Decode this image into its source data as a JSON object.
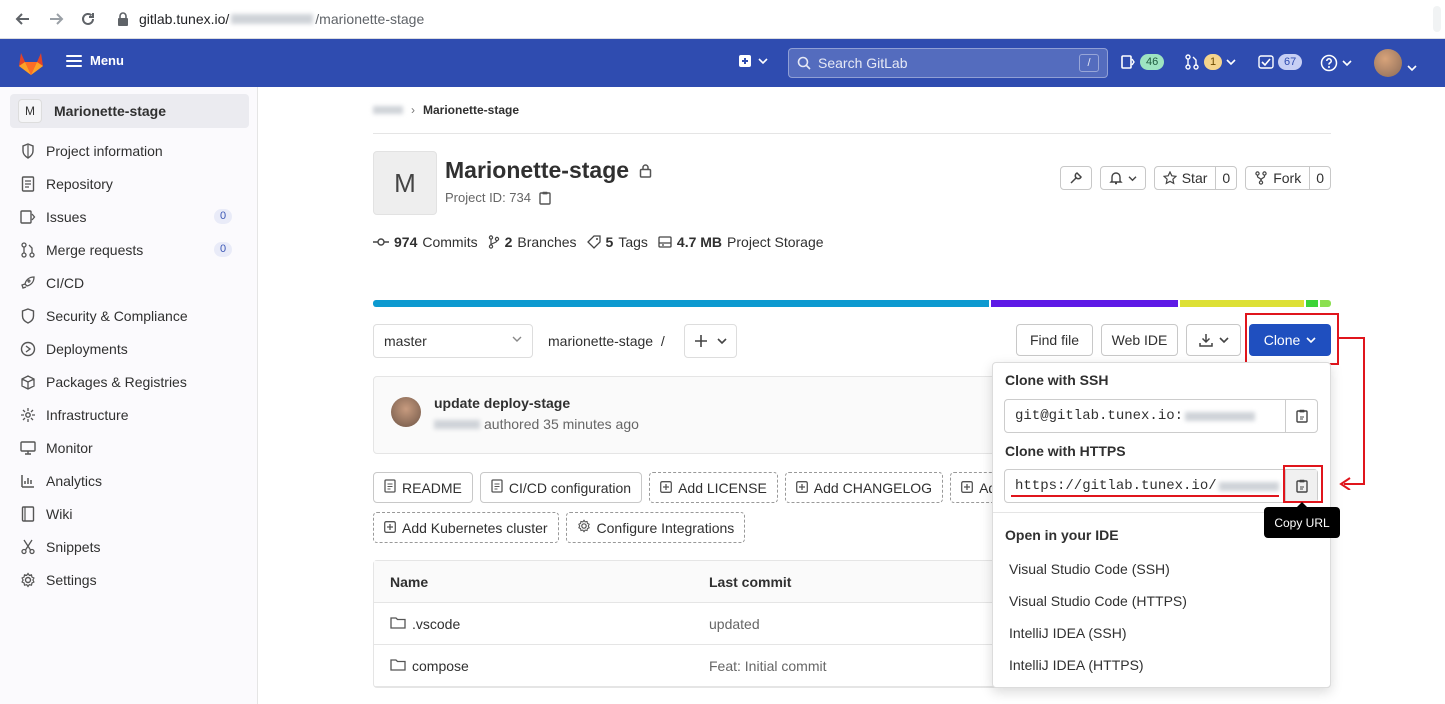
{
  "browser": {
    "url_host": "gitlab.tunex.io/",
    "url_path": "/marionette-stage"
  },
  "header": {
    "menu_label": "Menu",
    "search_placeholder": "Search GitLab",
    "search_shortcut": "/",
    "issues_count": "46",
    "mr_count": "1",
    "todos_count": "67"
  },
  "sidebar": {
    "project_initial": "M",
    "project_name": "Marionette-stage",
    "items": [
      {
        "label": "Project information",
        "icon": "info-icon"
      },
      {
        "label": "Repository",
        "icon": "doc-icon"
      },
      {
        "label": "Issues",
        "icon": "issues-icon",
        "badge": "0"
      },
      {
        "label": "Merge requests",
        "icon": "merge-request-icon",
        "badge": "0"
      },
      {
        "label": "CI/CD",
        "icon": "rocket-icon"
      },
      {
        "label": "Security & Compliance",
        "icon": "shield-icon"
      },
      {
        "label": "Deployments",
        "icon": "deployments-icon"
      },
      {
        "label": "Packages & Registries",
        "icon": "package-icon"
      },
      {
        "label": "Infrastructure",
        "icon": "cloud-icon"
      },
      {
        "label": "Monitor",
        "icon": "monitor-icon"
      },
      {
        "label": "Analytics",
        "icon": "chart-icon"
      },
      {
        "label": "Wiki",
        "icon": "book-icon"
      },
      {
        "label": "Snippets",
        "icon": "snippet-icon"
      },
      {
        "label": "Settings",
        "icon": "gear-icon"
      }
    ]
  },
  "main": {
    "breadcrumb_current": "Marionette-stage",
    "project_initial": "M",
    "project_title": "Marionette-stage",
    "project_id": "Project ID: 734",
    "star_label": "Star",
    "star_count": "0",
    "fork_label": "Fork",
    "fork_count": "0",
    "stats": {
      "commits_num": "974",
      "commits_label": "Commits",
      "branches_num": "2",
      "branches_label": "Branches",
      "tags_num": "5",
      "tags_label": "Tags",
      "storage_num": "4.7 MB",
      "storage_label": "Project Storage"
    },
    "lang_colors": [
      "#0d9ad0",
      "#5e1ae6",
      "#dde035",
      "#3dd438",
      "#8be050"
    ],
    "branch": "master",
    "path": "marionette-stage",
    "path_sep": "/",
    "find_file": "Find file",
    "web_ide": "Web IDE",
    "clone": "Clone",
    "commit": {
      "title": "update deploy-stage",
      "meta": "authored 35 minutes ago"
    },
    "quick_actions_row1": [
      "README",
      "CI/CD configuration",
      "Add LICENSE",
      "Add CHANGELOG",
      "Add"
    ],
    "quick_actions_row2": [
      "Add Kubernetes cluster",
      "Configure Integrations"
    ],
    "table": {
      "col_name": "Name",
      "col_last_commit": "Last commit",
      "rows": [
        {
          "name": ".vscode",
          "commit": "updated"
        },
        {
          "name": "compose",
          "commit": "Feat: Initial commit"
        }
      ]
    }
  },
  "clone_dropdown": {
    "ssh_title": "Clone with SSH",
    "ssh_url": "git@gitlab.tunex.io:",
    "https_title": "Clone with HTTPS",
    "https_url": "https://gitlab.tunex.io/",
    "ide_title": "Open in your IDE",
    "ide_options": [
      "Visual Studio Code (SSH)",
      "Visual Studio Code (HTTPS)",
      "IntelliJ IDEA (SSH)",
      "IntelliJ IDEA (HTTPS)"
    ],
    "tooltip": "Copy URL"
  },
  "colors": {
    "header_bg": "#2f4cb0",
    "clone_btn": "#1f4fbf",
    "highlight": "#e0151c"
  }
}
